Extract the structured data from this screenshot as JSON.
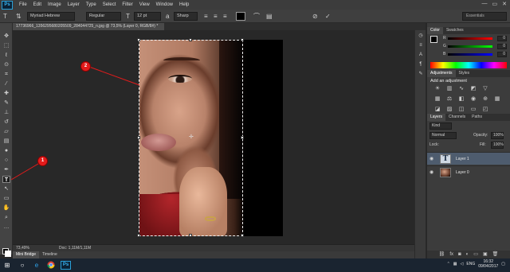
{
  "app": {
    "logo": "Ps"
  },
  "menu": [
    "File",
    "Edit",
    "Image",
    "Layer",
    "Type",
    "Select",
    "Filter",
    "View",
    "Window",
    "Help"
  ],
  "options": {
    "font_family": "Myriad Hebrew",
    "font_style": "Regular",
    "font_size": "12 pt",
    "antialias": "Sharp",
    "text_color": "#000000",
    "workspace": "Essentials"
  },
  "document": {
    "tab_title": "17736966_1356295680205509_284044725_n.jpg @ 73,5% (Layer 0, RGB/8#) *",
    "zoom": "73,49%",
    "doc_size": "Doc: 1,11M/1,11M"
  },
  "annotations": {
    "badge1": "1",
    "badge2": "2",
    "color": "#e31b1b"
  },
  "bottom_tabs": [
    "Mini Bridge",
    "Timeline"
  ],
  "color_panel": {
    "tabs": [
      "Color",
      "Swatches"
    ],
    "channels": [
      {
        "label": "R",
        "value": "0"
      },
      {
        "label": "G",
        "value": "0"
      },
      {
        "label": "B",
        "value": "0"
      }
    ]
  },
  "adjustments": {
    "tabs": [
      "Adjustments",
      "Styles"
    ],
    "title": "Add an adjustment"
  },
  "layers_panel": {
    "tabs": [
      "Layers",
      "Channels",
      "Paths"
    ],
    "filter": "Kind",
    "blend_mode": "Normal",
    "opacity_label": "Opacity:",
    "opacity": "100%",
    "lock_label": "Lock:",
    "fill_label": "Fill:",
    "fill": "100%",
    "layers": [
      {
        "name": "Layer 1",
        "type": "text",
        "thumb": "T"
      },
      {
        "name": "Layer 0",
        "type": "image"
      }
    ]
  },
  "taskbar": {
    "language": "ENG",
    "time": "16:32",
    "date": "09/04/2017"
  }
}
